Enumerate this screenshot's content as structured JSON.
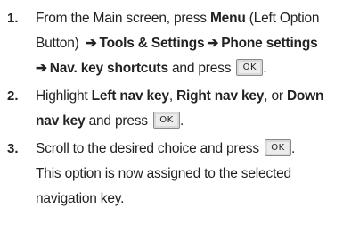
{
  "steps": [
    {
      "number": "1.",
      "line1_plain_a": "From the Main screen, press ",
      "line1_bold_menu": "Menu",
      "line2_plain_a": "(Left Option Button) ",
      "arrow": "➔",
      "tools": "Tools & Settings",
      "phone": "Phone settings",
      "nav": "Nav. key shortcuts",
      "and_press": " and press "
    },
    {
      "number": "2.",
      "highlight": "Highlight ",
      "left": "Left nav key",
      "comma1": ", ",
      "right": "Right nav key",
      "or": ", or ",
      "down": "Down nav key",
      "and_press": " and press "
    },
    {
      "number": "3.",
      "scroll": "Scroll to the desired choice and press ",
      "period": ".",
      "rest": "This option is now assigned to the selected navigation key."
    }
  ],
  "ok_key": {
    "label": "OK"
  }
}
